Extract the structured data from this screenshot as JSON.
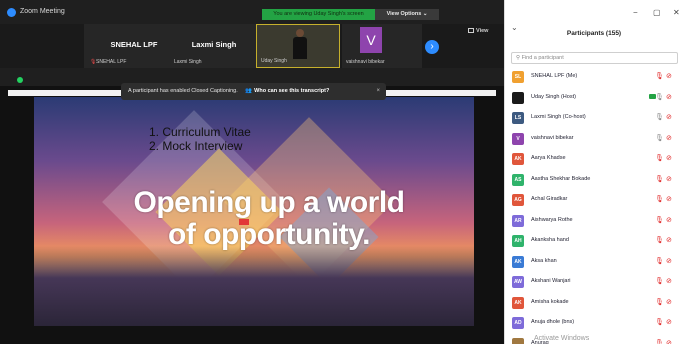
{
  "window": {
    "title": "Zoom Meeting"
  },
  "banner": {
    "viewing_text": "You are viewing Uday Singh's screen",
    "view_options": "View Options ⌄"
  },
  "strip": {
    "tiles": [
      {
        "name": "SNEHAL LPF",
        "caption": "SNEHAL LPF"
      },
      {
        "name": "Laxmi Singh",
        "caption": "Laxmi Singh"
      },
      {
        "name": "",
        "caption": "Uday Singh"
      },
      {
        "avatar_letter": "V",
        "caption": "vaishnavi bibekar"
      }
    ],
    "view_label": "View"
  },
  "toast": {
    "message": "A participant has enabled Closed Captioning.",
    "link": "Who can see this transcript?",
    "close": "×"
  },
  "slide": {
    "items": [
      "1.  Curriculum Vitae",
      "2.  Mock Interview"
    ],
    "headline_line1": "Opening up a world",
    "headline_line2": "of opportunity."
  },
  "panel": {
    "title": "Participants (155)",
    "search_placeholder": "Find a participant",
    "controls": {
      "minimize": "−",
      "maximize": "▢",
      "close": "✕"
    },
    "participants": [
      {
        "initials": "SL",
        "name": "SNEHAL LPF (Me)",
        "color": "#f0a030",
        "mic_on": false,
        "cam_on": false
      },
      {
        "initials": "",
        "name": "Uday Singh (Host)",
        "color": "#1a1a1a",
        "mic_on": true,
        "cam_on": true
      },
      {
        "initials": "LS",
        "name": "Laxmi Singh (Co-host)",
        "color": "#3d5a80",
        "mic_on": true,
        "cam_on": false
      },
      {
        "initials": "V",
        "name": "vaishnavi bibekar",
        "color": "#8e44ad",
        "mic_on": true,
        "cam_on": false
      },
      {
        "initials": "AK",
        "name": "Aarya Khadse",
        "color": "#e0563b",
        "mic_on": false,
        "cam_on": false
      },
      {
        "initials": "AS",
        "name": "Aastha Shekhar Bokade",
        "color": "#2fb36b",
        "mic_on": false,
        "cam_on": false
      },
      {
        "initials": "AG",
        "name": "Achal Giradkar",
        "color": "#e0563b",
        "mic_on": false,
        "cam_on": false
      },
      {
        "initials": "AR",
        "name": "Aishwarya Rothe",
        "color": "#7e6bd9",
        "mic_on": false,
        "cam_on": false
      },
      {
        "initials": "AH",
        "name": "Akanksha hand",
        "color": "#2fb36b",
        "mic_on": false,
        "cam_on": false
      },
      {
        "initials": "AK",
        "name": "Aksa khan",
        "color": "#3a7bd5",
        "mic_on": false,
        "cam_on": false
      },
      {
        "initials": "AW",
        "name": "Akshani Wanjari",
        "color": "#7e6bd9",
        "mic_on": false,
        "cam_on": false
      },
      {
        "initials": "AK",
        "name": "Amisha kokade",
        "color": "#e0563b",
        "mic_on": false,
        "cam_on": false
      },
      {
        "initials": "AD",
        "name": "Anuja dhole (bns)",
        "color": "#7e6bd9",
        "mic_on": false,
        "cam_on": false
      },
      {
        "initials": "",
        "name": "Anurag",
        "color": "#a07840",
        "mic_on": false,
        "cam_on": false
      }
    ]
  },
  "watermark": "Activate Windows"
}
